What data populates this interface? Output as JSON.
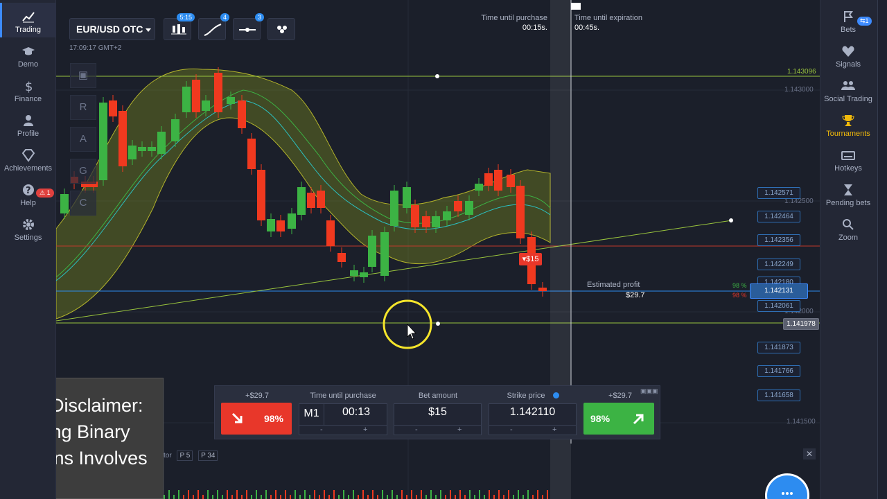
{
  "left_nav": [
    {
      "label": "Trading",
      "icon": "chart-line-icon"
    },
    {
      "label": "Demo",
      "icon": "graduation-cap-icon"
    },
    {
      "label": "Finance",
      "icon": "dollar-icon"
    },
    {
      "label": "Profile",
      "icon": "user-icon"
    },
    {
      "label": "Achievements",
      "icon": "diamond-icon"
    },
    {
      "label": "Help",
      "icon": "question-icon",
      "badge": "1"
    },
    {
      "label": "Settings",
      "icon": "gear-icon"
    }
  ],
  "right_nav": [
    {
      "label": "Bets",
      "icon": "history-icon",
      "badge": "1"
    },
    {
      "label": "Signals",
      "icon": "heart-pulse-icon"
    },
    {
      "label": "Social Trading",
      "icon": "users-icon"
    },
    {
      "label": "Tournaments",
      "icon": "trophy-icon"
    },
    {
      "label": "Hotkeys",
      "icon": "keyboard-icon"
    },
    {
      "label": "Pending bets",
      "icon": "hourglass-icon"
    },
    {
      "label": "Zoom",
      "icon": "zoom-icon"
    }
  ],
  "toolbar": {
    "pair": "EUR/USD OTC",
    "chart_type_badge": "5:15",
    "drawing_badge": "4",
    "indicator_badge": "3",
    "time": "17:09:17 GMT+2"
  },
  "vertical_tools": [
    "R",
    "A",
    "G",
    "C"
  ],
  "timers": {
    "purchase_label": "Time until purchase",
    "purchase_value": "00:15s.",
    "expiration_label": "Time until expiration",
    "expiration_value": "00:45s."
  },
  "price_axis": {
    "labels": [
      "1.143000",
      "1.142500",
      "1.142000",
      "1.141500"
    ],
    "green_line": "1.143096",
    "boxes": [
      "1.142571",
      "1.142464",
      "1.142356",
      "1.142249",
      "1.142180",
      "1.142061",
      "1.141873",
      "1.141766",
      "1.141658"
    ],
    "current": "1.142131",
    "lower_line": "1.141978"
  },
  "trade_marker": "▾$15",
  "estimated_profit": {
    "label": "Estimated profit",
    "value": "$29.7",
    "pct_up": "98 %",
    "pct_down": "98 %"
  },
  "panel": {
    "put_profit": "+$29.7",
    "put_pct": "98%",
    "time_label": "Time until purchase",
    "timeframe": "M1",
    "time_value": "00:13",
    "amount_label": "Bet amount",
    "amount_value": "$15",
    "strike_label": "Strike price",
    "strike_value": "1.142110",
    "call_profit": "+$29.7",
    "call_pct": "98%",
    "minus": "-",
    "plus": "+"
  },
  "disclaimer": "Risk Disclaimer: Trading Binary Options Involves Risk!",
  "indicator_bar": {
    "label": "tor",
    "p1": "P 5",
    "p2": "P 34"
  },
  "colors": {
    "up": "#3cb344",
    "down": "#f0391f",
    "accent": "#2d8cf0",
    "band": "#8a9a1e"
  }
}
